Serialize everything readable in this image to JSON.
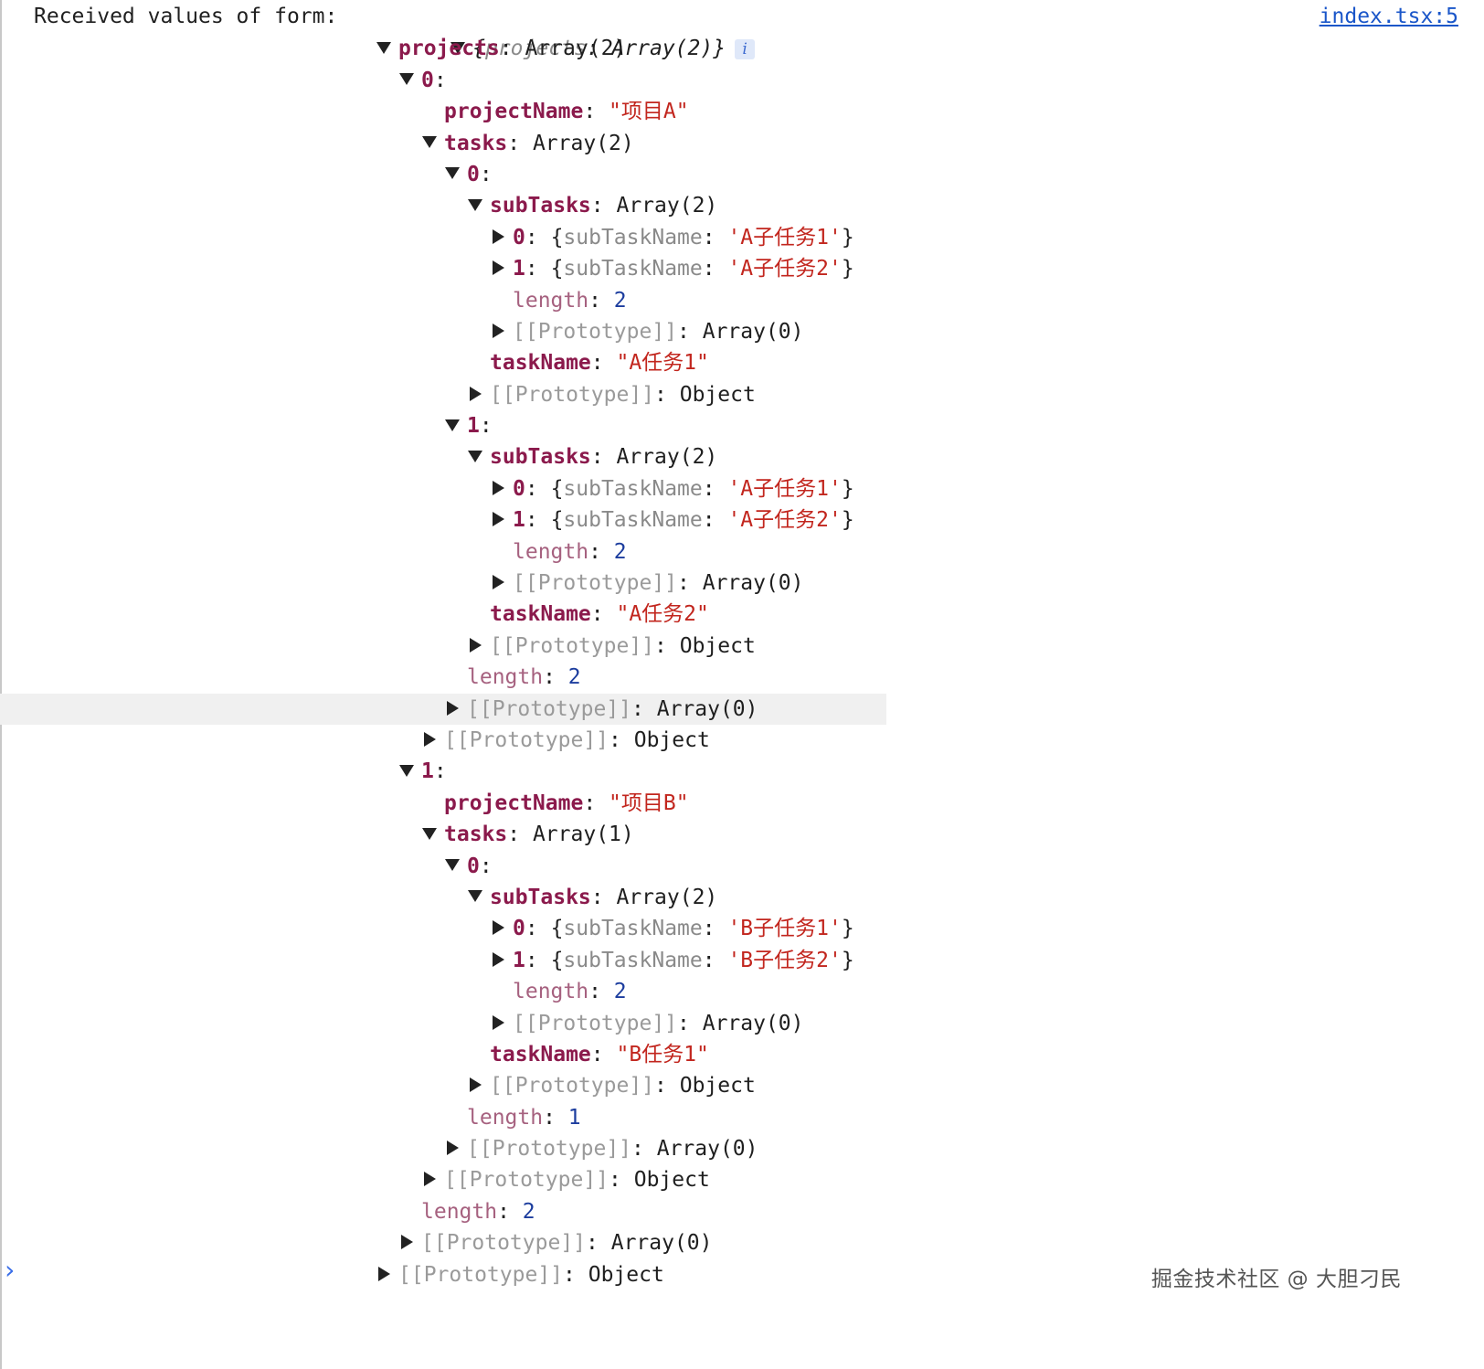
{
  "console": {
    "message_label": "Received values of form:",
    "source_link": "index.tsx:5",
    "preview": {
      "open": "{",
      "key": "projects",
      "sep": ": ",
      "value": "Array(2)",
      "close": "}",
      "info": "i"
    }
  },
  "tree": [
    {
      "indent": 0,
      "toggle": "down",
      "key": "projects",
      "key_style": "k",
      "sep": ": ",
      "value": "Array(2)",
      "value_style": "p"
    },
    {
      "indent": 1,
      "toggle": "down",
      "key": "0",
      "key_style": "k",
      "sep": ":",
      "value": "",
      "value_style": "p"
    },
    {
      "indent": 2,
      "toggle": "none",
      "key": "projectName",
      "key_style": "k",
      "sep": ": ",
      "value": "\"项目A\"",
      "value_style": "s"
    },
    {
      "indent": 2,
      "toggle": "down",
      "key": "tasks",
      "key_style": "k",
      "sep": ": ",
      "value": "Array(2)",
      "value_style": "p"
    },
    {
      "indent": 3,
      "toggle": "down",
      "key": "0",
      "key_style": "k",
      "sep": ":",
      "value": "",
      "value_style": "p"
    },
    {
      "indent": 4,
      "toggle": "down",
      "key": "subTasks",
      "key_style": "k",
      "sep": ": ",
      "value": "Array(2)",
      "value_style": "p"
    },
    {
      "indent": 5,
      "toggle": "right",
      "key": "0",
      "key_style": "k",
      "sep": ": ",
      "obj_key": "subTaskName",
      "obj_val": "'A子任务1'"
    },
    {
      "indent": 5,
      "toggle": "right",
      "key": "1",
      "key_style": "k",
      "sep": ": ",
      "obj_key": "subTaskName",
      "obj_val": "'A子任务2'"
    },
    {
      "indent": 5,
      "toggle": "none",
      "key": "length",
      "key_style": "kp",
      "sep": ": ",
      "value": "2",
      "value_style": "n"
    },
    {
      "indent": 5,
      "toggle": "right",
      "key": "[[Prototype]]",
      "key_style": "k-grey",
      "sep": ": ",
      "value": "Array(0)",
      "value_style": "p"
    },
    {
      "indent": 4,
      "toggle": "none",
      "key": "taskName",
      "key_style": "k",
      "sep": ": ",
      "value": "\"A任务1\"",
      "value_style": "s"
    },
    {
      "indent": 4,
      "toggle": "right",
      "key": "[[Prototype]]",
      "key_style": "k-grey",
      "sep": ": ",
      "value": "Object",
      "value_style": "p"
    },
    {
      "indent": 3,
      "toggle": "down",
      "key": "1",
      "key_style": "k",
      "sep": ":",
      "value": "",
      "value_style": "p"
    },
    {
      "indent": 4,
      "toggle": "down",
      "key": "subTasks",
      "key_style": "k",
      "sep": ": ",
      "value": "Array(2)",
      "value_style": "p"
    },
    {
      "indent": 5,
      "toggle": "right",
      "key": "0",
      "key_style": "k",
      "sep": ": ",
      "obj_key": "subTaskName",
      "obj_val": "'A子任务1'"
    },
    {
      "indent": 5,
      "toggle": "right",
      "key": "1",
      "key_style": "k",
      "sep": ": ",
      "obj_key": "subTaskName",
      "obj_val": "'A子任务2'"
    },
    {
      "indent": 5,
      "toggle": "none",
      "key": "length",
      "key_style": "kp",
      "sep": ": ",
      "value": "2",
      "value_style": "n"
    },
    {
      "indent": 5,
      "toggle": "right",
      "key": "[[Prototype]]",
      "key_style": "k-grey",
      "sep": ": ",
      "value": "Array(0)",
      "value_style": "p"
    },
    {
      "indent": 4,
      "toggle": "none",
      "key": "taskName",
      "key_style": "k",
      "sep": ": ",
      "value": "\"A任务2\"",
      "value_style": "s"
    },
    {
      "indent": 4,
      "toggle": "right",
      "key": "[[Prototype]]",
      "key_style": "k-grey",
      "sep": ": ",
      "value": "Object",
      "value_style": "p"
    },
    {
      "indent": 3,
      "toggle": "none",
      "key": "length",
      "key_style": "kp",
      "sep": ": ",
      "value": "2",
      "value_style": "n"
    },
    {
      "indent": 3,
      "toggle": "right",
      "key": "[[Prototype]]",
      "key_style": "k-grey",
      "sep": ": ",
      "value": "Array(0)",
      "value_style": "p",
      "highlight": true
    },
    {
      "indent": 2,
      "toggle": "right",
      "key": "[[Prototype]]",
      "key_style": "k-grey",
      "sep": ": ",
      "value": "Object",
      "value_style": "p"
    },
    {
      "indent": 1,
      "toggle": "down",
      "key": "1",
      "key_style": "k",
      "sep": ":",
      "value": "",
      "value_style": "p"
    },
    {
      "indent": 2,
      "toggle": "none",
      "key": "projectName",
      "key_style": "k",
      "sep": ": ",
      "value": "\"项目B\"",
      "value_style": "s"
    },
    {
      "indent": 2,
      "toggle": "down",
      "key": "tasks",
      "key_style": "k",
      "sep": ": ",
      "value": "Array(1)",
      "value_style": "p"
    },
    {
      "indent": 3,
      "toggle": "down",
      "key": "0",
      "key_style": "k",
      "sep": ":",
      "value": "",
      "value_style": "p"
    },
    {
      "indent": 4,
      "toggle": "down",
      "key": "subTasks",
      "key_style": "k",
      "sep": ": ",
      "value": "Array(2)",
      "value_style": "p"
    },
    {
      "indent": 5,
      "toggle": "right",
      "key": "0",
      "key_style": "k",
      "sep": ": ",
      "obj_key": "subTaskName",
      "obj_val": "'B子任务1'"
    },
    {
      "indent": 5,
      "toggle": "right",
      "key": "1",
      "key_style": "k",
      "sep": ": ",
      "obj_key": "subTaskName",
      "obj_val": "'B子任务2'"
    },
    {
      "indent": 5,
      "toggle": "none",
      "key": "length",
      "key_style": "kp",
      "sep": ": ",
      "value": "2",
      "value_style": "n"
    },
    {
      "indent": 5,
      "toggle": "right",
      "key": "[[Prototype]]",
      "key_style": "k-grey",
      "sep": ": ",
      "value": "Array(0)",
      "value_style": "p"
    },
    {
      "indent": 4,
      "toggle": "none",
      "key": "taskName",
      "key_style": "k",
      "sep": ": ",
      "value": "\"B任务1\"",
      "value_style": "s"
    },
    {
      "indent": 4,
      "toggle": "right",
      "key": "[[Prototype]]",
      "key_style": "k-grey",
      "sep": ": ",
      "value": "Object",
      "value_style": "p"
    },
    {
      "indent": 3,
      "toggle": "none",
      "key": "length",
      "key_style": "kp",
      "sep": ": ",
      "value": "1",
      "value_style": "n"
    },
    {
      "indent": 3,
      "toggle": "right",
      "key": "[[Prototype]]",
      "key_style": "k-grey",
      "sep": ": ",
      "value": "Array(0)",
      "value_style": "p"
    },
    {
      "indent": 2,
      "toggle": "right",
      "key": "[[Prototype]]",
      "key_style": "k-grey",
      "sep": ": ",
      "value": "Object",
      "value_style": "p"
    },
    {
      "indent": 1,
      "toggle": "none",
      "key": "length",
      "key_style": "kp",
      "sep": ": ",
      "value": "2",
      "value_style": "n"
    },
    {
      "indent": 1,
      "toggle": "right",
      "key": "[[Prototype]]",
      "key_style": "k-grey",
      "sep": ": ",
      "value": "Array(0)",
      "value_style": "p"
    },
    {
      "indent": 0,
      "toggle": "right",
      "key": "[[Prototype]]",
      "key_style": "k-grey",
      "sep": ": ",
      "value": "Object",
      "value_style": "p"
    }
  ],
  "prompt": "›",
  "watermark": "掘金技术社区 @ 大胆刁民"
}
